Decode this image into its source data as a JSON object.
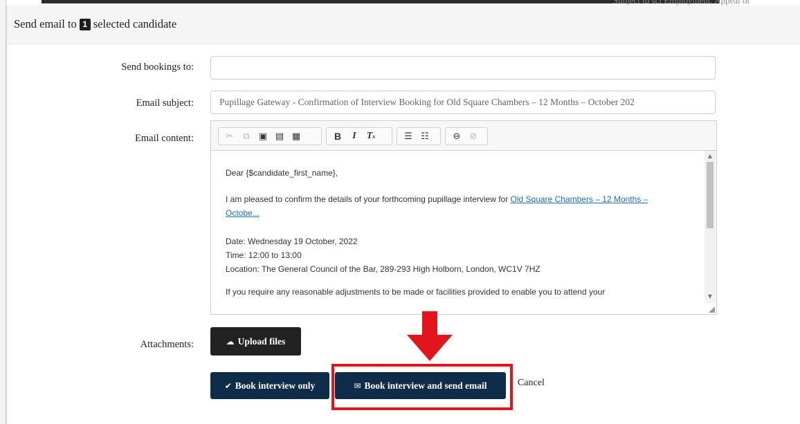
{
  "modal": {
    "title_prefix": "Send email to",
    "selected_count": "1",
    "title_suffix": "selected candidate"
  },
  "form": {
    "send_bookings_label": "Send bookings to:",
    "send_bookings_value": "",
    "subject_label": "Email subject:",
    "subject_value": "Pupillage Gateway - Confirmation of Interview Booking for Old Square Chambers – 12 Months – October 202",
    "content_label": "Email content:",
    "attachments_label": "Attachments:"
  },
  "toolbar": {
    "groups": [
      [
        "cut-icon",
        "copy-icon",
        "paste-icon",
        "paste-text-icon",
        "paste-word-icon"
      ],
      [
        "bold-icon",
        "italic-icon",
        "remove-format-icon"
      ],
      [
        "numbered-list-icon",
        "bulleted-list-icon"
      ],
      [
        "link-icon",
        "unlink-icon"
      ]
    ]
  },
  "email_body": {
    "greeting": "Dear {$candidate_first_name},",
    "intro_text": "I am pleased to confirm the details of your forthcoming pupillage interview for ",
    "intro_link": "Old Square Chambers – 12 Months – Octobe...",
    "date_line": "Date: Wednesday 19 October, 2022",
    "time_line": "Time: 12:00 to 13:00",
    "location_line": "Location: The General Council of the Bar, 289-293 High Holborn, London, WC1V 7HZ",
    "cutoff_line": "If you require any reasonable adjustments to be made or facilities provided to enable you to attend your"
  },
  "buttons": {
    "upload_files": "Upload files",
    "book_only": "Book interview only",
    "book_and_send": "Book interview and send email",
    "cancel": "Cancel"
  },
  "background": {
    "partial_text": "Subject to sci Employment, Appeal or"
  },
  "colors": {
    "navy_button": "#0f2c4b",
    "dark_button": "#222222",
    "annotation_red": "#e2151c",
    "link": "#1a6fb3"
  }
}
